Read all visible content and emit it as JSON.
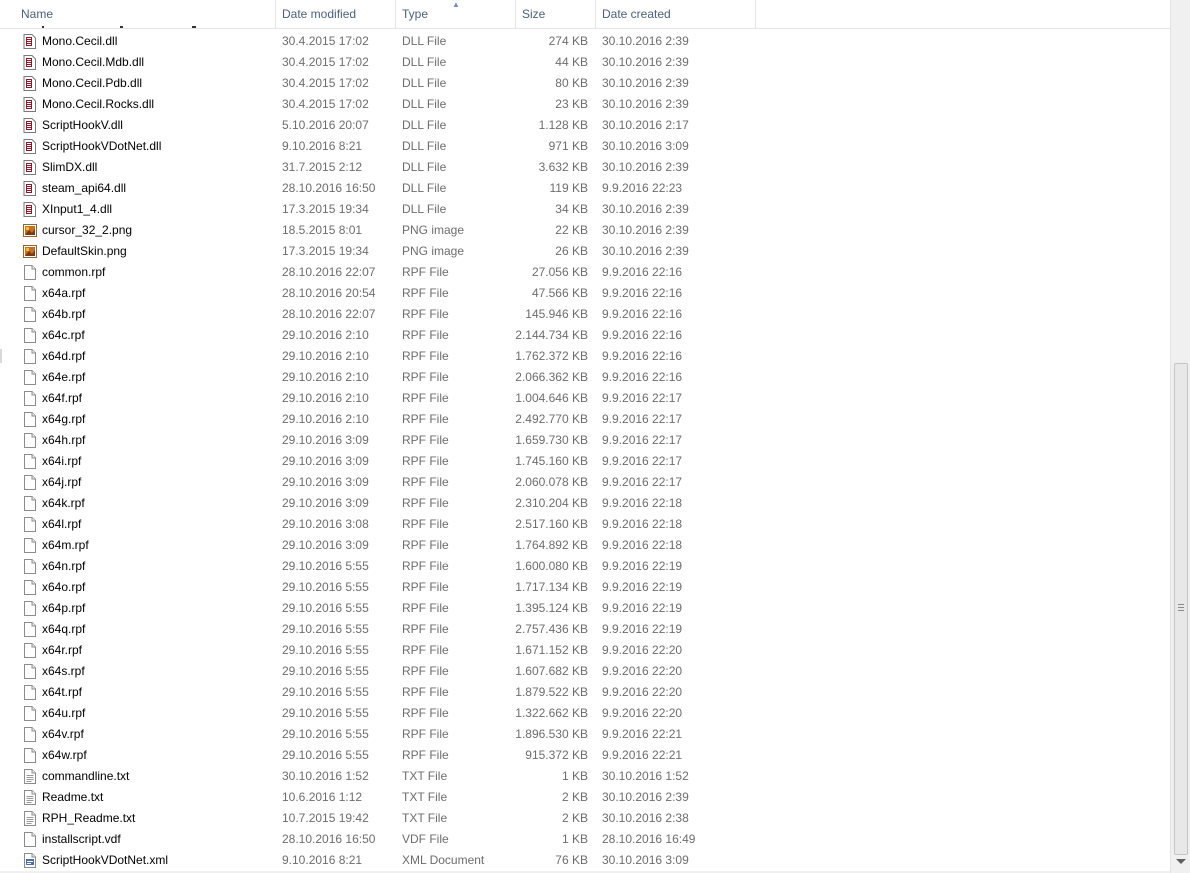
{
  "columns": {
    "name": "Name",
    "date_modified": "Date modified",
    "type": "Type",
    "size": "Size",
    "date_created": "Date created"
  },
  "colors": {
    "header_text": "#4c607a",
    "secondary_text": "#6d6d6d",
    "dll_icon": "#8a1a2a",
    "png_icon": "#c87020",
    "xml_icon": "#4a6fa5"
  },
  "files": [
    {
      "name": "Mono.Cecil.dll",
      "date": "30.4.2015 17:02",
      "type": "DLL File",
      "size": "274 KB",
      "created": "30.10.2016 2:39",
      "icon": "dll-icon"
    },
    {
      "name": "Mono.Cecil.Mdb.dll",
      "date": "30.4.2015 17:02",
      "type": "DLL File",
      "size": "44 KB",
      "created": "30.10.2016 2:39",
      "icon": "dll-icon"
    },
    {
      "name": "Mono.Cecil.Pdb.dll",
      "date": "30.4.2015 17:02",
      "type": "DLL File",
      "size": "80 KB",
      "created": "30.10.2016 2:39",
      "icon": "dll-icon"
    },
    {
      "name": "Mono.Cecil.Rocks.dll",
      "date": "30.4.2015 17:02",
      "type": "DLL File",
      "size": "23 KB",
      "created": "30.10.2016 2:39",
      "icon": "dll-icon"
    },
    {
      "name": "ScriptHookV.dll",
      "date": "5.10.2016 20:07",
      "type": "DLL File",
      "size": "1.128 KB",
      "created": "30.10.2016 2:17",
      "icon": "dll-icon"
    },
    {
      "name": "ScriptHookVDotNet.dll",
      "date": "9.10.2016 8:21",
      "type": "DLL File",
      "size": "971 KB",
      "created": "30.10.2016 3:09",
      "icon": "dll-icon"
    },
    {
      "name": "SlimDX.dll",
      "date": "31.7.2015 2:12",
      "type": "DLL File",
      "size": "3.632 KB",
      "created": "30.10.2016 2:39",
      "icon": "dll-icon"
    },
    {
      "name": "steam_api64.dll",
      "date": "28.10.2016 16:50",
      "type": "DLL File",
      "size": "119 KB",
      "created": "9.9.2016 22:23",
      "icon": "dll-icon"
    },
    {
      "name": "XInput1_4.dll",
      "date": "17.3.2015 19:34",
      "type": "DLL File",
      "size": "34 KB",
      "created": "30.10.2016 2:39",
      "icon": "dll-icon"
    },
    {
      "name": "cursor_32_2.png",
      "date": "18.5.2015 8:01",
      "type": "PNG image",
      "size": "22 KB",
      "created": "30.10.2016 2:39",
      "icon": "png-icon"
    },
    {
      "name": "DefaultSkin.png",
      "date": "17.3.2015 19:34",
      "type": "PNG image",
      "size": "26 KB",
      "created": "30.10.2016 2:39",
      "icon": "png-icon"
    },
    {
      "name": "common.rpf",
      "date": "28.10.2016 22:07",
      "type": "RPF File",
      "size": "27.056 KB",
      "created": "9.9.2016 22:16",
      "icon": "file-icon"
    },
    {
      "name": "x64a.rpf",
      "date": "28.10.2016 20:54",
      "type": "RPF File",
      "size": "47.566 KB",
      "created": "9.9.2016 22:16",
      "icon": "file-icon"
    },
    {
      "name": "x64b.rpf",
      "date": "28.10.2016 22:07",
      "type": "RPF File",
      "size": "145.946 KB",
      "created": "9.9.2016 22:16",
      "icon": "file-icon"
    },
    {
      "name": "x64c.rpf",
      "date": "29.10.2016 2:10",
      "type": "RPF File",
      "size": "2.144.734 KB",
      "created": "9.9.2016 22:16",
      "icon": "file-icon"
    },
    {
      "name": "x64d.rpf",
      "date": "29.10.2016 2:10",
      "type": "RPF File",
      "size": "1.762.372 KB",
      "created": "9.9.2016 22:16",
      "icon": "file-icon"
    },
    {
      "name": "x64e.rpf",
      "date": "29.10.2016 2:10",
      "type": "RPF File",
      "size": "2.066.362 KB",
      "created": "9.9.2016 22:16",
      "icon": "file-icon"
    },
    {
      "name": "x64f.rpf",
      "date": "29.10.2016 2:10",
      "type": "RPF File",
      "size": "1.004.646 KB",
      "created": "9.9.2016 22:17",
      "icon": "file-icon"
    },
    {
      "name": "x64g.rpf",
      "date": "29.10.2016 2:10",
      "type": "RPF File",
      "size": "2.492.770 KB",
      "created": "9.9.2016 22:17",
      "icon": "file-icon"
    },
    {
      "name": "x64h.rpf",
      "date": "29.10.2016 3:09",
      "type": "RPF File",
      "size": "1.659.730 KB",
      "created": "9.9.2016 22:17",
      "icon": "file-icon"
    },
    {
      "name": "x64i.rpf",
      "date": "29.10.2016 3:09",
      "type": "RPF File",
      "size": "1.745.160 KB",
      "created": "9.9.2016 22:17",
      "icon": "file-icon"
    },
    {
      "name": "x64j.rpf",
      "date": "29.10.2016 3:09",
      "type": "RPF File",
      "size": "2.060.078 KB",
      "created": "9.9.2016 22:17",
      "icon": "file-icon"
    },
    {
      "name": "x64k.rpf",
      "date": "29.10.2016 3:09",
      "type": "RPF File",
      "size": "2.310.204 KB",
      "created": "9.9.2016 22:18",
      "icon": "file-icon"
    },
    {
      "name": "x64l.rpf",
      "date": "29.10.2016 3:08",
      "type": "RPF File",
      "size": "2.517.160 KB",
      "created": "9.9.2016 22:18",
      "icon": "file-icon"
    },
    {
      "name": "x64m.rpf",
      "date": "29.10.2016 3:09",
      "type": "RPF File",
      "size": "1.764.892 KB",
      "created": "9.9.2016 22:18",
      "icon": "file-icon"
    },
    {
      "name": "x64n.rpf",
      "date": "29.10.2016 5:55",
      "type": "RPF File",
      "size": "1.600.080 KB",
      "created": "9.9.2016 22:19",
      "icon": "file-icon"
    },
    {
      "name": "x64o.rpf",
      "date": "29.10.2016 5:55",
      "type": "RPF File",
      "size": "1.717.134 KB",
      "created": "9.9.2016 22:19",
      "icon": "file-icon"
    },
    {
      "name": "x64p.rpf",
      "date": "29.10.2016 5:55",
      "type": "RPF File",
      "size": "1.395.124 KB",
      "created": "9.9.2016 22:19",
      "icon": "file-icon"
    },
    {
      "name": "x64q.rpf",
      "date": "29.10.2016 5:55",
      "type": "RPF File",
      "size": "2.757.436 KB",
      "created": "9.9.2016 22:19",
      "icon": "file-icon"
    },
    {
      "name": "x64r.rpf",
      "date": "29.10.2016 5:55",
      "type": "RPF File",
      "size": "1.671.152 KB",
      "created": "9.9.2016 22:20",
      "icon": "file-icon"
    },
    {
      "name": "x64s.rpf",
      "date": "29.10.2016 5:55",
      "type": "RPF File",
      "size": "1.607.682 KB",
      "created": "9.9.2016 22:20",
      "icon": "file-icon"
    },
    {
      "name": "x64t.rpf",
      "date": "29.10.2016 5:55",
      "type": "RPF File",
      "size": "1.879.522 KB",
      "created": "9.9.2016 22:20",
      "icon": "file-icon"
    },
    {
      "name": "x64u.rpf",
      "date": "29.10.2016 5:55",
      "type": "RPF File",
      "size": "1.322.662 KB",
      "created": "9.9.2016 22:20",
      "icon": "file-icon"
    },
    {
      "name": "x64v.rpf",
      "date": "29.10.2016 5:55",
      "type": "RPF File",
      "size": "1.896.530 KB",
      "created": "9.9.2016 22:21",
      "icon": "file-icon"
    },
    {
      "name": "x64w.rpf",
      "date": "29.10.2016 5:55",
      "type": "RPF File",
      "size": "915.372 KB",
      "created": "9.9.2016 22:21",
      "icon": "file-icon"
    },
    {
      "name": "commandline.txt",
      "date": "30.10.2016 1:52",
      "type": "TXT File",
      "size": "1 KB",
      "created": "30.10.2016 1:52",
      "icon": "text-file-icon"
    },
    {
      "name": "Readme.txt",
      "date": "10.6.2016 1:12",
      "type": "TXT File",
      "size": "2 KB",
      "created": "30.10.2016 2:39",
      "icon": "text-file-icon"
    },
    {
      "name": "RPH_Readme.txt",
      "date": "10.7.2015 19:42",
      "type": "TXT File",
      "size": "2 KB",
      "created": "30.10.2016 2:38",
      "icon": "text-file-icon"
    },
    {
      "name": "installscript.vdf",
      "date": "28.10.2016 16:50",
      "type": "VDF File",
      "size": "1 KB",
      "created": "28.10.2016 16:49",
      "icon": "file-icon"
    },
    {
      "name": "ScriptHookVDotNet.xml",
      "date": "9.10.2016 8:21",
      "type": "XML Document",
      "size": "76 KB",
      "created": "30.10.2016 3:09",
      "icon": "xml-file-icon"
    }
  ]
}
